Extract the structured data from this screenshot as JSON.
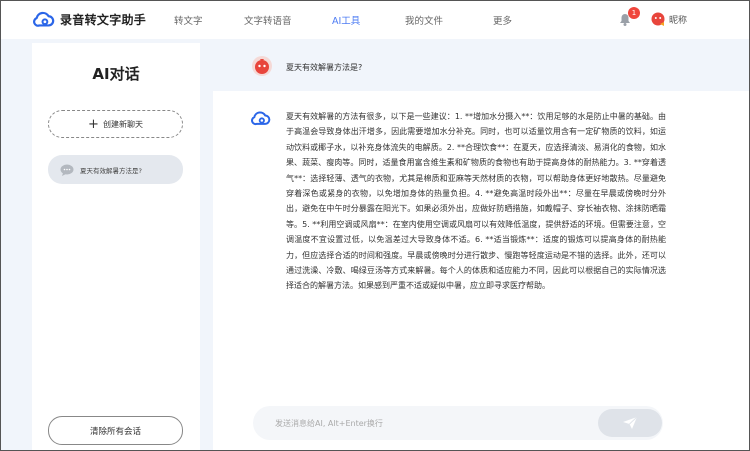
{
  "app": {
    "name": "录音转文字助手"
  },
  "nav": {
    "items": [
      {
        "label": "转文字",
        "active": false
      },
      {
        "label": "文字转语音",
        "active": false
      },
      {
        "label": "AI工具",
        "active": true
      },
      {
        "label": "我的文件",
        "active": false
      },
      {
        "label": "更多",
        "active": false
      }
    ]
  },
  "header": {
    "notification_count": "1",
    "user_name": "昵称"
  },
  "sidebar": {
    "title": "AI对话",
    "new_chat_label": "创建新聊天",
    "history": [
      {
        "label": "夏天有效解暑方法是?"
      }
    ],
    "clear_label": "清除所有会话"
  },
  "conversation": {
    "question": "夏天有效解暑方法是?",
    "answer": "夏天有效解暑的方法有很多，以下是一些建议：1. **增加水分摄入**：饮用足够的水是防止中暑的基础。由于高温会导致身体出汗增多，因此需要增加水分补充。同时，也可以适量饮用含有一定矿物质的饮料，如运动饮料或椰子水，以补充身体流失的电解质。2. **合理饮食**：在夏天，应选择清淡、易消化的食物，如水果、蔬菜、瘦肉等。同时，适量食用富含维生素和矿物质的食物也有助于提高身体的耐热能力。3. **穿着透气**：选择轻薄、透气的衣物，尤其是棉质和亚麻等天然材质的衣物，可以帮助身体更好地散热。尽量避免穿着深色或紧身的衣物，以免增加身体的热量负担。4. **避免高温时段外出**：尽量在早晨或傍晚时分外出，避免在中午时分暴露在阳光下。如果必须外出，应做好防晒措施，如戴帽子、穿长袖衣物、涂抹防晒霜等。5. **利用空调或风扇**：在室内使用空调或风扇可以有效降低温度，提供舒适的环境。但需要注意，空调温度不宜设置过低，以免温差过大导致身体不适。6. **适当锻炼**：适度的锻炼可以提高身体的耐热能力，但应选择合适的时间和强度。早晨或傍晚时分进行散步、慢跑等轻度运动是不错的选择。此外，还可以通过洗澡、冷敷、喝绿豆汤等方式来解暑。每个人的体质和适应能力不同，因此可以根据自己的实际情况选择适合的解暑方法。如果感到严重不适或疑似中暑，应立即寻求医疗帮助。"
  },
  "input": {
    "placeholder": "发送消息给AI, Alt+Enter换行",
    "value": ""
  },
  "icons": {
    "logo": "cloud-logo-icon",
    "bell": "bell-icon",
    "avatar": "red-mascot-avatar",
    "chat": "chat-bubble-icon",
    "send": "paper-plane-icon",
    "plus": "plus-icon"
  },
  "colors": {
    "accent": "#4d7cf3",
    "badge": "#f0463c",
    "background": "#f1f5fb",
    "logo": "#2b66e8"
  }
}
